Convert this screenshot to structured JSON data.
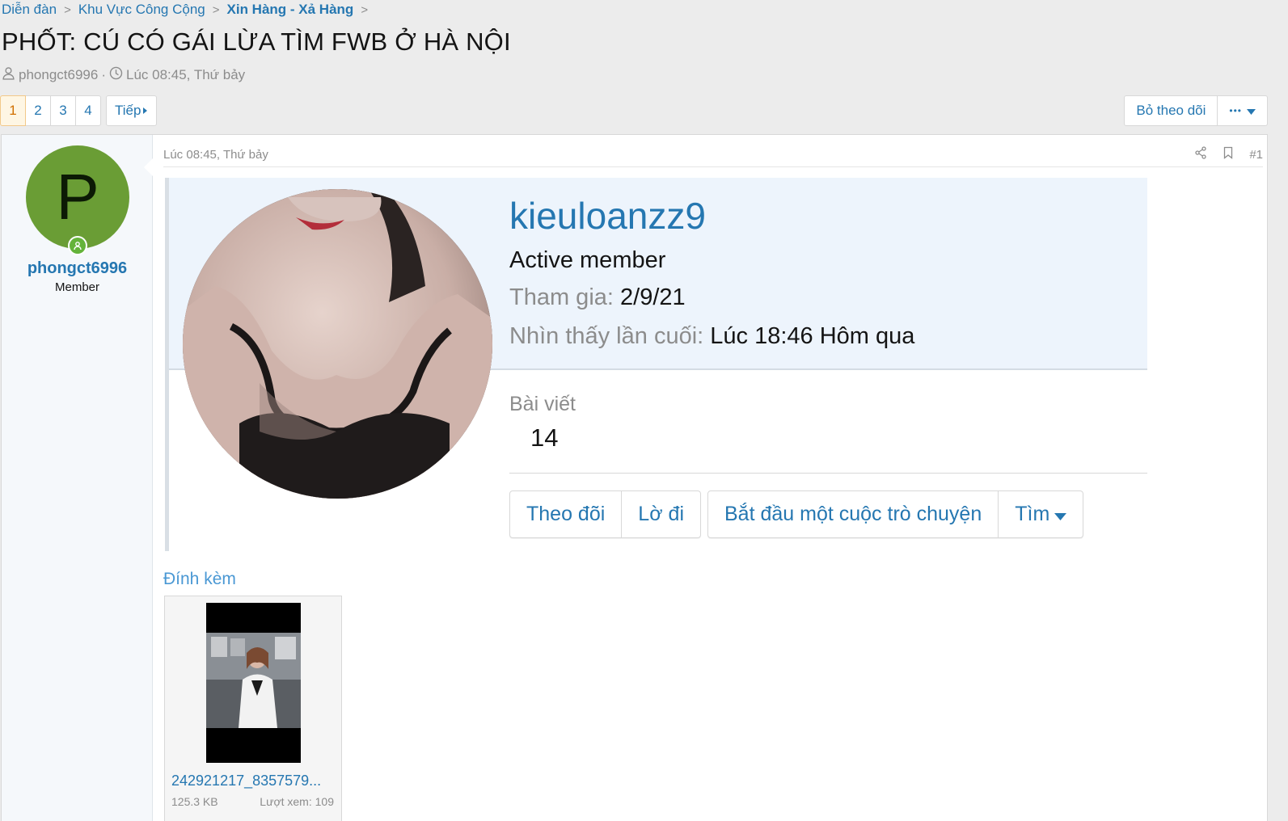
{
  "breadcrumb": {
    "items": [
      "Diễn đàn",
      "Khu Vực Công Cộng",
      "Xin Hàng - Xả Hàng"
    ],
    "separator": ">"
  },
  "thread": {
    "title": "PHỐT: CÚ CÓ GÁI LỪA TÌM FWB Ở HÀ NỘI",
    "author": "phongct6996",
    "meta_sep": "·",
    "time": "Lúc 08:45, Thứ bảy"
  },
  "pagination": {
    "pages": [
      "1",
      "2",
      "3",
      "4"
    ],
    "current": "1",
    "next": "Tiếp"
  },
  "thread_actions": {
    "unwatch": "Bỏ theo dõi",
    "more": "•••"
  },
  "post": {
    "author": {
      "initial": "P",
      "avatar_color": "#6a9d35",
      "username": "phongct6996",
      "title": "Member"
    },
    "date": "Lúc 08:45, Thứ bảy",
    "number": "#1",
    "member_card": {
      "name": "kieuloanzz9",
      "role": "Active member",
      "joined_label": "Tham gia:",
      "joined": "2/9/21",
      "last_seen_label": "Nhìn thấy lần cuối:",
      "last_seen": "Lúc 18:46 Hôm qua",
      "stat_label": "Bài viết",
      "stat_value": "14",
      "buttons": {
        "follow": "Theo đõi",
        "ignore": "Lờ đi",
        "conversation": "Bắt đầu một cuộc trò chuyện",
        "find": "Tìm"
      }
    },
    "attachments": {
      "title": "Đính kèm",
      "items": [
        {
          "name": "242921217_8357579...",
          "size": "125.3 KB",
          "views": "Lượt xem: 109"
        }
      ]
    }
  },
  "colors": {
    "link": "#2577b1",
    "online": "#64b33a",
    "active_page": "#d06f00"
  }
}
